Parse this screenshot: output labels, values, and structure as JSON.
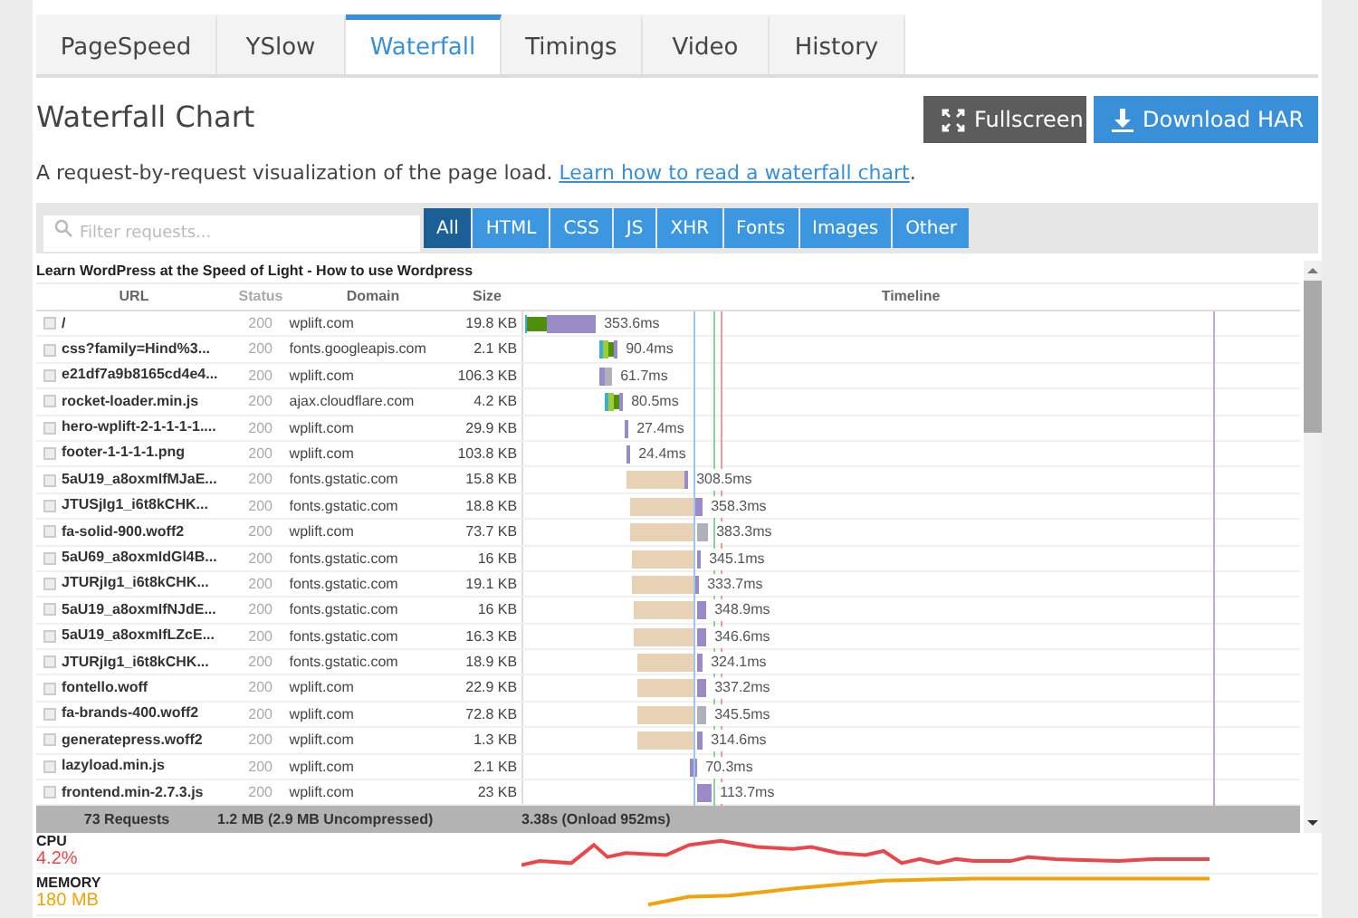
{
  "tabs": [
    {
      "label": "PageSpeed",
      "selected": false
    },
    {
      "label": "YSlow",
      "selected": false
    },
    {
      "label": "Waterfall",
      "selected": true
    },
    {
      "label": "Timings",
      "selected": false
    },
    {
      "label": "Video",
      "selected": false
    },
    {
      "label": "History",
      "selected": false
    }
  ],
  "heading": "Waterfall Chart",
  "buttons": [
    {
      "kind": "fullscreen",
      "label": "Fullscreen"
    },
    {
      "kind": "download",
      "label": "Download HAR"
    }
  ],
  "description": {
    "text": "A request-by-request visualization of the page load.",
    "link": "Learn how to read a waterfall chart",
    "end": "."
  },
  "filter": {
    "placeholder": "Filter requests...",
    "types": [
      {
        "label": "All",
        "selected": true
      },
      {
        "label": "HTML",
        "selected": false
      },
      {
        "label": "CSS",
        "selected": false
      },
      {
        "label": "JS",
        "selected": false
      },
      {
        "label": "XHR",
        "selected": false
      },
      {
        "label": "Fonts",
        "selected": false
      },
      {
        "label": "Images",
        "selected": false
      },
      {
        "label": "Other",
        "selected": false
      }
    ]
  },
  "waterfall": {
    "title": "Learn WordPress at the Speed of Light - How to use Wordpress",
    "columns": [
      "URL",
      "Status",
      "Domain",
      "Size",
      "Timeline"
    ],
    "rows": [
      {
        "url": "/",
        "status": "200",
        "domain": "wplift.com",
        "size": "19.8 KB",
        "time": "353.6ms"
      },
      {
        "url": "css?family=Hind%3...",
        "status": "200",
        "domain": "fonts.googleapis.com",
        "size": "2.1 KB",
        "time": "90.4ms"
      },
      {
        "url": "e21df7a9b8165cd4e4...",
        "status": "200",
        "domain": "wplift.com",
        "size": "106.3 KB",
        "time": "61.7ms"
      },
      {
        "url": "rocket-loader.min.js",
        "status": "200",
        "domain": "ajax.cloudflare.com",
        "size": "4.2 KB",
        "time": "80.5ms"
      },
      {
        "url": "hero-wplift-2-1-1-1-1....",
        "status": "200",
        "domain": "wplift.com",
        "size": "29.9 KB",
        "time": "27.4ms"
      },
      {
        "url": "footer-1-1-1-1.png",
        "status": "200",
        "domain": "wplift.com",
        "size": "103.8 KB",
        "time": "24.4ms"
      },
      {
        "url": "5aU19_a8oxmIfMJaE...",
        "status": "200",
        "domain": "fonts.gstatic.com",
        "size": "15.8 KB",
        "time": "308.5ms"
      },
      {
        "url": "JTUSjIg1_i6t8kCHK...",
        "status": "200",
        "domain": "fonts.gstatic.com",
        "size": "18.8 KB",
        "time": "358.3ms"
      },
      {
        "url": "fa-solid-900.woff2",
        "status": "200",
        "domain": "wplift.com",
        "size": "73.7 KB",
        "time": "383.3ms"
      },
      {
        "url": "5aU69_a8oxmIdGl4B...",
        "status": "200",
        "domain": "fonts.gstatic.com",
        "size": "16 KB",
        "time": "345.1ms"
      },
      {
        "url": "JTURjIg1_i6t8kCHK...",
        "status": "200",
        "domain": "fonts.gstatic.com",
        "size": "19.1 KB",
        "time": "333.7ms"
      },
      {
        "url": "5aU19_a8oxmIfNJdE...",
        "status": "200",
        "domain": "fonts.gstatic.com",
        "size": "16 KB",
        "time": "348.9ms"
      },
      {
        "url": "5aU19_a8oxmIfLZcE...",
        "status": "200",
        "domain": "fonts.gstatic.com",
        "size": "16.3 KB",
        "time": "346.6ms"
      },
      {
        "url": "JTURjIg1_i6t8kCHK...",
        "status": "200",
        "domain": "fonts.gstatic.com",
        "size": "18.9 KB",
        "time": "324.1ms"
      },
      {
        "url": "fontello.woff",
        "status": "200",
        "domain": "wplift.com",
        "size": "22.9 KB",
        "time": "337.2ms"
      },
      {
        "url": "fa-brands-400.woff2",
        "status": "200",
        "domain": "wplift.com",
        "size": "72.8 KB",
        "time": "345.5ms"
      },
      {
        "url": "generatepress.woff2",
        "status": "200",
        "domain": "wplift.com",
        "size": "1.3 KB",
        "time": "314.6ms"
      },
      {
        "url": "lazyload.min.js",
        "status": "200",
        "domain": "wplift.com",
        "size": "2.1 KB",
        "time": "70.3ms"
      },
      {
        "url": "frontend.min-2.7.3.js",
        "status": "200",
        "domain": "wplift.com",
        "size": "23 KB",
        "time": "113.7ms"
      }
    ],
    "summary": {
      "requests": "73 Requests",
      "size": "1.2 MB  (2.9 MB Uncompressed)",
      "time": "3.38s  (Onload 952ms)"
    }
  },
  "metrics": [
    {
      "label": "CPU",
      "value": "4.2%",
      "color": "#e8474c"
    },
    {
      "label": "MEMORY",
      "value": "180 MB",
      "color": "#f0a30a"
    }
  ]
}
